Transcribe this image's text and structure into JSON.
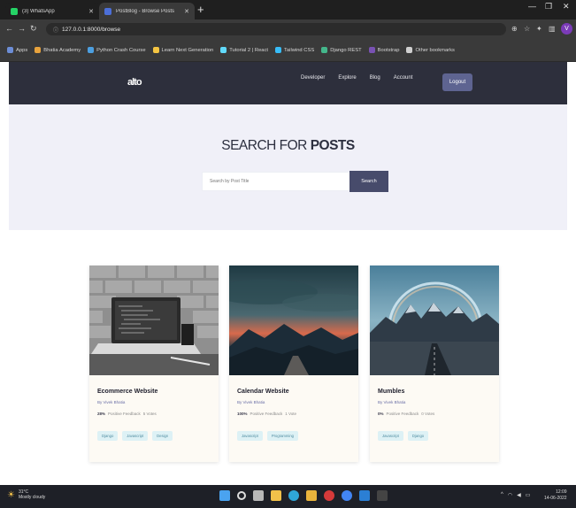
{
  "browser": {
    "tabs": [
      {
        "label": "(3) WhatsApp",
        "favicon_color": "#25d366",
        "icon": "whatsapp-icon"
      },
      {
        "label": "PostBlog - Browse Posts",
        "favicon_color": "#4c6fd8",
        "icon": "site-favicon"
      }
    ],
    "url": "127.0.0.1:8000/browse",
    "bookmarks": [
      {
        "label": "Apps",
        "color": "#6c8dd6"
      },
      {
        "label": "Bhatia Academy",
        "color": "#e8a33d"
      },
      {
        "label": "Python Crash Course",
        "color": "#4c9fe0"
      },
      {
        "label": "Learn Next Generation",
        "color": "#f5c542"
      },
      {
        "label": "Tutorial 2 | React",
        "color": "#61dafb"
      },
      {
        "label": "Tailwind CSS",
        "color": "#38bdf8"
      },
      {
        "label": "Django REST",
        "color": "#44b78b"
      },
      {
        "label": "Bootstrap",
        "color": "#7952b3"
      },
      {
        "label": "Other bookmarks",
        "color": "#cfcfcf"
      }
    ],
    "profile_initial": "V"
  },
  "site": {
    "logo": "alto",
    "nav": [
      "Developer",
      "Explore",
      "Blog",
      "Account"
    ],
    "login_label": "Logout"
  },
  "hero": {
    "title_light": "SEARCH FOR",
    "title_bold": "POSTS",
    "search_placeholder": "Search by Post Title",
    "search_button": "Search"
  },
  "posts": [
    {
      "title": "Ecommerce Website",
      "author": "By Vivek Bhatia",
      "count": "28%",
      "meta": "Positive Feedback",
      "votes": "5 Votes",
      "tags": [
        "Django",
        "Javascript",
        "Design"
      ],
      "image": "laptop-photo"
    },
    {
      "title": "Calendar Website",
      "author": "By Vivek Bhatia",
      "count": "100%",
      "meta": "Positive Feedback",
      "votes": "1 Vote",
      "tags": [
        "Javascript",
        "Programming"
      ],
      "image": "mountain-sunset-photo"
    },
    {
      "title": "Mumbles",
      "author": "By Vivek Bhatia",
      "count": "0%",
      "meta": "Positive Feedback",
      "votes": "0 Votes",
      "tags": [
        "Javascript",
        "Django"
      ],
      "image": "rainbow-mountain-photo"
    }
  ],
  "taskbar": {
    "weather_temp": "31°C",
    "weather_desc": "Mostly cloudy",
    "time": "12:09",
    "date": "14-06-2022"
  }
}
